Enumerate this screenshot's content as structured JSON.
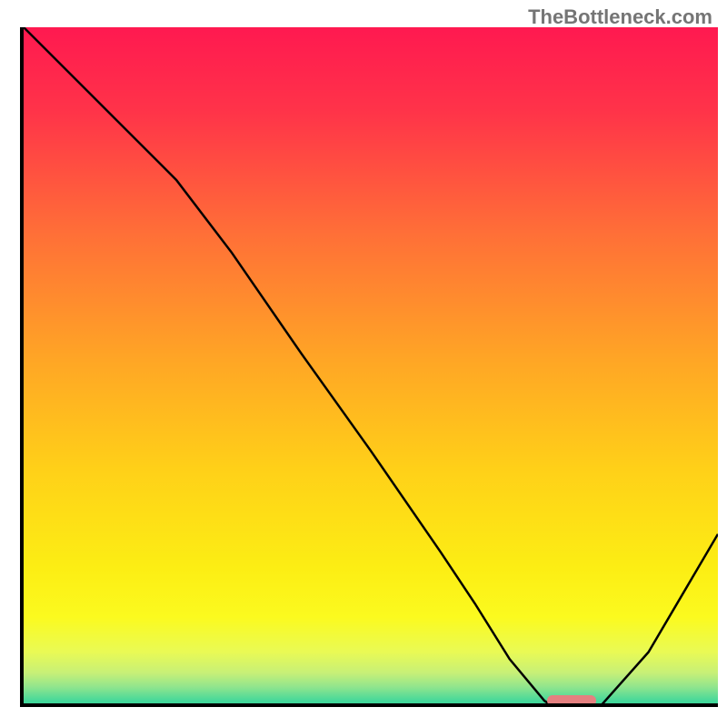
{
  "watermark": "TheBottleneck.com",
  "chart_data": {
    "type": "line",
    "title": "",
    "xlabel": "",
    "ylabel": "",
    "xlim": [
      0,
      100
    ],
    "ylim": [
      0,
      100
    ],
    "grid": false,
    "legend": false,
    "gradient_stops": [
      {
        "offset": 0,
        "color": "#ff1950"
      },
      {
        "offset": 12,
        "color": "#ff3349"
      },
      {
        "offset": 30,
        "color": "#ff7037"
      },
      {
        "offset": 48,
        "color": "#ffa625"
      },
      {
        "offset": 64,
        "color": "#ffd118"
      },
      {
        "offset": 78,
        "color": "#fcee14"
      },
      {
        "offset": 85,
        "color": "#fbfa1f"
      },
      {
        "offset": 90,
        "color": "#e9fa55"
      },
      {
        "offset": 93,
        "color": "#c7f077"
      },
      {
        "offset": 95,
        "color": "#91e58d"
      },
      {
        "offset": 97,
        "color": "#46d89a"
      },
      {
        "offset": 100,
        "color": "#0bcd9c"
      }
    ],
    "series": [
      {
        "name": "bottleneck-curve",
        "x": [
          0,
          10,
          20,
          22,
          30,
          40,
          50,
          60,
          65,
          70,
          75,
          78,
          82,
          90,
          100
        ],
        "y": [
          100,
          90,
          80,
          78,
          67.5,
          53,
          39,
          24.5,
          17,
          9,
          3,
          1,
          1,
          10,
          27
        ]
      }
    ],
    "annotations": [
      {
        "name": "optimal-marker",
        "x_start": 75,
        "x_end": 82,
        "y": 1,
        "color": "#e58080"
      }
    ]
  }
}
